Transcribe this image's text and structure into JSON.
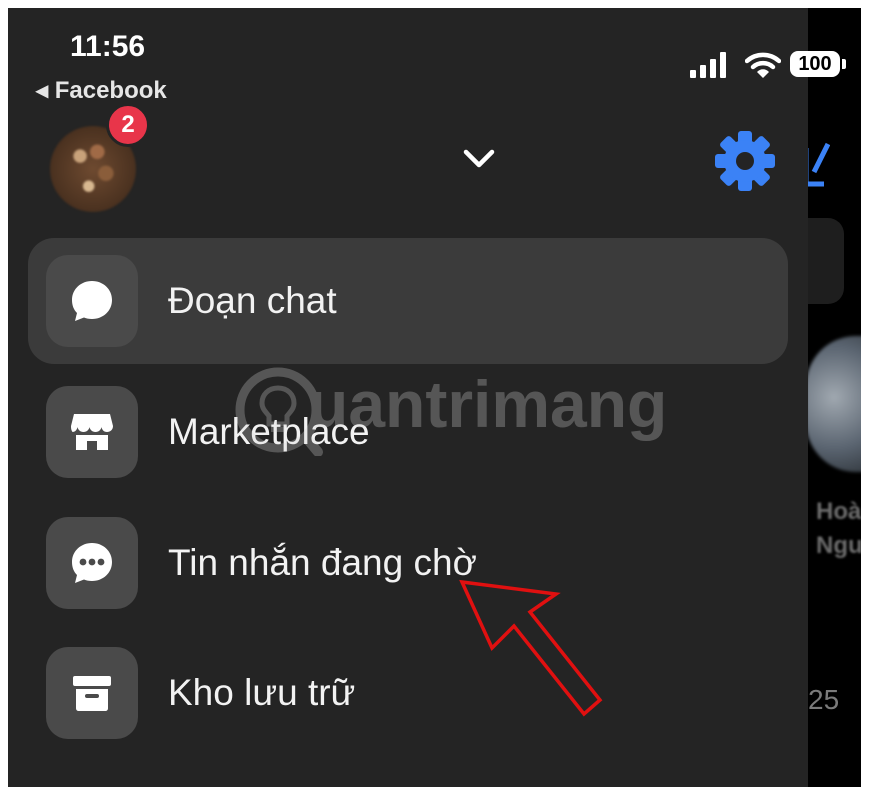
{
  "statusbar": {
    "time": "11:56",
    "back_label": "◂ Facebook",
    "battery": "100"
  },
  "header": {
    "notification_count": "2",
    "accent_color": "#3b82f6",
    "icons": [
      "avatar",
      "chevron-down-icon",
      "gear-icon"
    ]
  },
  "menu": {
    "items": [
      {
        "label": "Đoạn chat",
        "icon": "chat-bubble-icon",
        "active": true
      },
      {
        "label": "Marketplace",
        "icon": "store-icon",
        "active": false
      },
      {
        "label": "Tin nhắn đang chờ",
        "icon": "message-dots-icon",
        "active": false
      },
      {
        "label": "Kho lưu trữ",
        "icon": "archive-icon",
        "active": false
      }
    ]
  },
  "background": {
    "story_name_1": "Hoà",
    "story_name_2": "Nguy",
    "time_fragment": "25"
  },
  "watermark": {
    "text": "uantrimang"
  },
  "annotation": {
    "arrow_color": "#e01010"
  }
}
